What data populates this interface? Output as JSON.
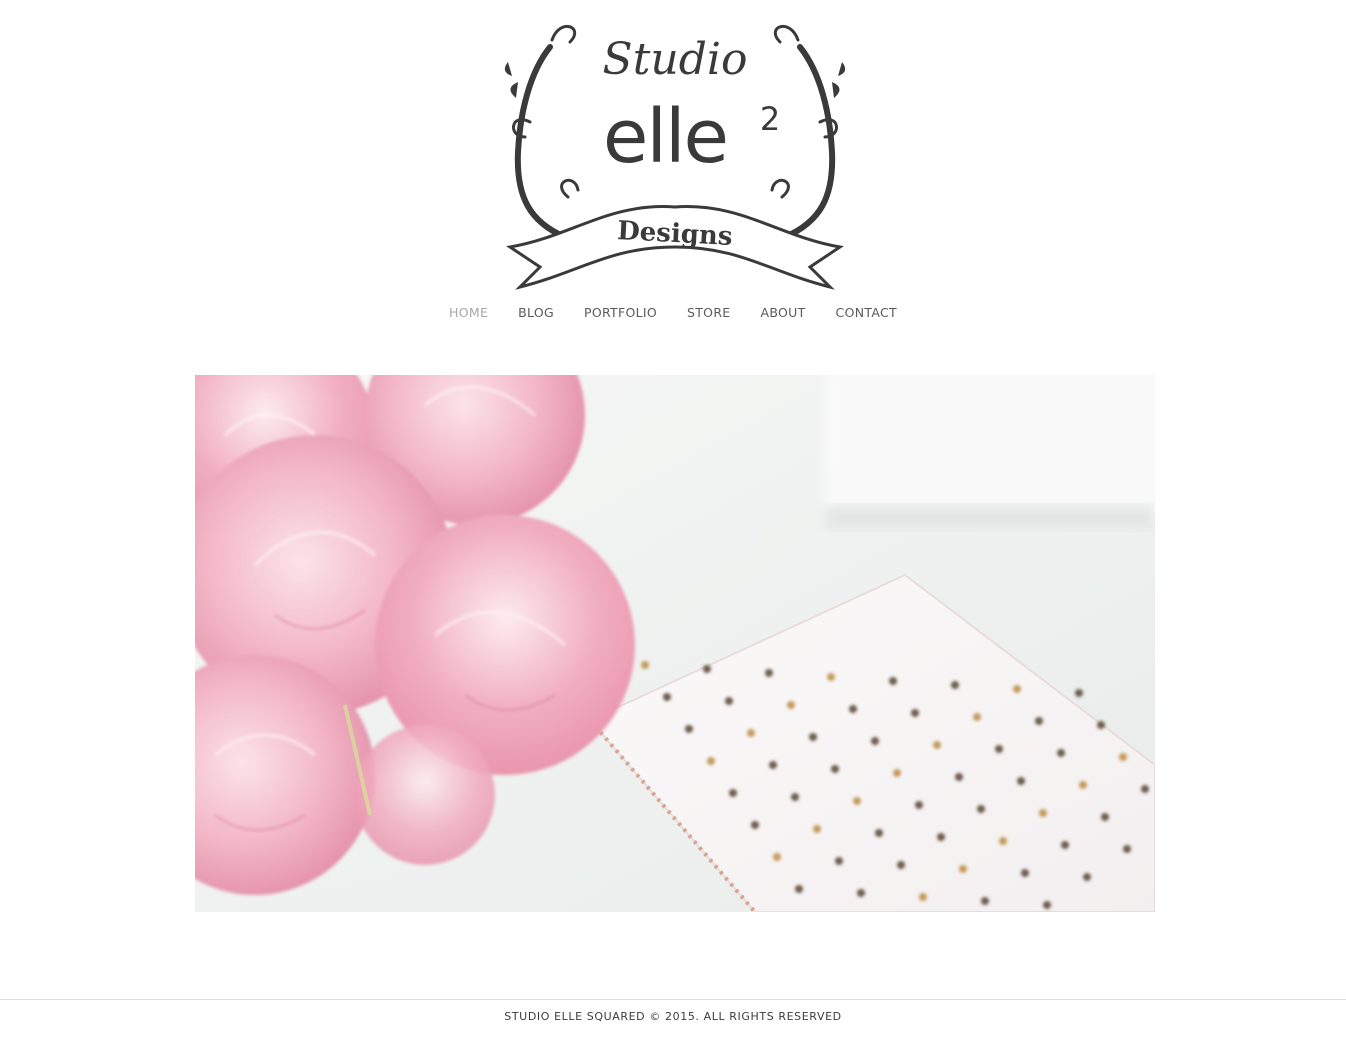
{
  "logo": {
    "line1": "Studio",
    "line2": "elle",
    "superscript": "2",
    "banner": "Designs"
  },
  "nav": {
    "items": [
      {
        "label": "HOME",
        "active": true
      },
      {
        "label": "BLOG",
        "active": false
      },
      {
        "label": "PORTFOLIO",
        "active": false
      },
      {
        "label": "STORE",
        "active": false
      },
      {
        "label": "ABOUT",
        "active": false
      },
      {
        "label": "CONTACT",
        "active": false
      }
    ]
  },
  "hero": {
    "image": "pink-peonies-and-polka-dot-notebook-photo"
  },
  "footer": {
    "copyright": "STUDIO ELLE SQUARED © 2015. ALL RIGHTS RESERVED"
  },
  "colors": {
    "nav_text": "#5a5a5a",
    "nav_active": "#a8a8a8",
    "logo_ink": "#3a3a3a",
    "footer_text": "#3c3c3c"
  }
}
